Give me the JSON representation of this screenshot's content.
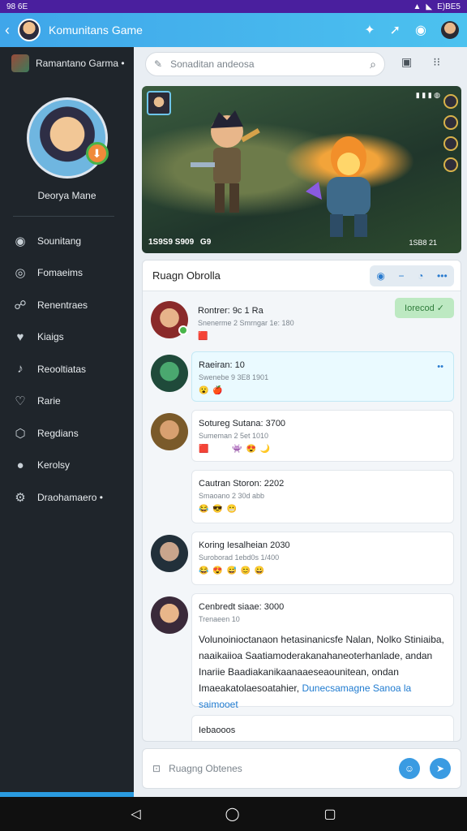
{
  "statusbar": {
    "time": "98 6E",
    "right": "E)BE5"
  },
  "appbar": {
    "title": "Komunitans Game",
    "back_icon": "arrow-left-icon"
  },
  "sidebar": {
    "header": "Ramantano Garma •",
    "profile_name": "Deorya Mane",
    "items": [
      {
        "label": "Sounitang",
        "icon": "home-icon"
      },
      {
        "label": "Fomaeims",
        "icon": "chat-icon"
      },
      {
        "label": "Renentraes",
        "icon": "people-icon"
      },
      {
        "label": "Kiaigs",
        "icon": "heart-icon"
      },
      {
        "label": "Reooltiatas",
        "icon": "bell-icon"
      },
      {
        "label": "Rarie",
        "icon": "shield-icon"
      },
      {
        "label": "Regdians",
        "icon": "badge-icon"
      },
      {
        "label": "Kerolsy",
        "icon": "user-icon"
      },
      {
        "label": "Draohamaero •",
        "icon": "settings-icon"
      }
    ]
  },
  "search": {
    "placeholder": "Sonaditan andeosa"
  },
  "banner": {
    "stat": "1S9S9 S909  G9",
    "count": "1SB8 21"
  },
  "chat": {
    "title": "Ruagn Obrolla",
    "messages": [
      {
        "name": "Rontrer:",
        "time": "9c 1 Ra",
        "sub": "Snenerme 2 Smrngar 1e: 180",
        "tag": "Iorecod ✓",
        "emoji": "🟥"
      },
      {
        "name": "Raeiran:",
        "time": "10",
        "sub": "Swenebe 9 3E8 1901",
        "emoji": "😮 🍎"
      },
      {
        "name": "Sotureg Sutana:",
        "time": "3700",
        "sub": "Sumeman 2 5et 1010",
        "emoji": "🟥     👾 😍 🌙"
      },
      {
        "name": "Cautran Storon:",
        "time": "2202",
        "sub": "Smaoano 2 30d abb",
        "emoji": "😂 😎 😬"
      },
      {
        "name": "Koring Iesalheian",
        "time": "2030",
        "sub": "Suroborad 1ebd0s 1/400",
        "emoji": "😂 😍 😅 😊 😀"
      },
      {
        "name": "Cenbredt siaae:",
        "time": "3000",
        "sub": "Trenaeen 10",
        "body": "Volunoinioctanaon hetasinanicsfe Nalan, Nolko Stiniaiba, naaikaiioa Saatiamoderakanahaneoterhanlade, andan Inariie Baadiakanikaanaaeseaounitean, ondan Imaeakatolaesoatahier,",
        "link": "Dunecsamagne",
        "link2": "Sanoa la saimooet"
      }
    ],
    "footer_note": "Iebaooos"
  },
  "composer": {
    "placeholder": "Ruagng Obtenes"
  },
  "nav": {
    "back": "◁",
    "home": "◯",
    "recent": "▢"
  }
}
